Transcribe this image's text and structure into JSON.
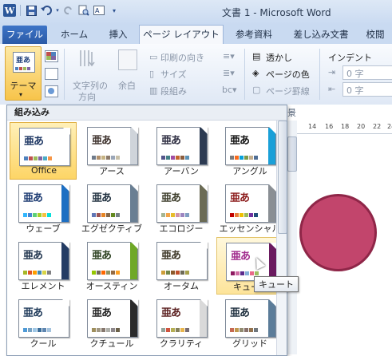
{
  "window": {
    "title": "文書 1 - Microsoft Word"
  },
  "qat": {
    "icons": [
      "word-logo-icon",
      "save-icon",
      "undo-icon",
      "redo-icon",
      "print-preview-icon",
      "customize-icon"
    ],
    "word_glyph": "W"
  },
  "tabs": [
    {
      "label": "ファイル"
    },
    {
      "label": "ホーム"
    },
    {
      "label": "挿入"
    },
    {
      "label": "ページ レイアウト"
    },
    {
      "label": "参考資料"
    },
    {
      "label": "差し込み文書"
    },
    {
      "label": "校閲"
    }
  ],
  "ribbon": {
    "theme_label": "テーマ",
    "orientation": "印刷の向き",
    "size": "サイズ",
    "columns": "段組み",
    "text_direction_1": "文字列の",
    "text_direction_2": "方向",
    "margins": "余白",
    "watermark": "透かし",
    "page_color": "ページの色",
    "page_borders": "ページ罫線",
    "indent": "インデント",
    "indent_left": "0 字",
    "indent_right": "0 字",
    "background_group": "景"
  },
  "ruler": {
    "ticks": [
      "14",
      "16",
      "18",
      "20",
      "22",
      "24"
    ]
  },
  "gallery": {
    "header": "組み込み",
    "items": [
      {
        "label": "Office",
        "jp": "亜あ",
        "text_color": "#1f3864",
        "stripe": "",
        "swatches": [
          "#4f81bd",
          "#c0504d",
          "#9bbb59",
          "#8064a2",
          "#4bacc6",
          "#f79646"
        ]
      },
      {
        "label": "アース",
        "jp": "亜あ",
        "text_color": "#3b2f2a",
        "stripe": "#cfd4da",
        "swatches": [
          "#6f7b8b",
          "#b1906b",
          "#c6b383",
          "#8d7b6b",
          "#9aa6b8",
          "#c7bfa8"
        ]
      },
      {
        "label": "アーバン",
        "jp": "亜あ",
        "text_color": "#2b2b3f",
        "stripe": "#2d3b52",
        "swatches": [
          "#53548a",
          "#438086",
          "#a04da3",
          "#c4652d",
          "#8b5d3d",
          "#5c92b5"
        ]
      },
      {
        "label": "アングル",
        "jp": "亜あ",
        "text_color": "#111111",
        "stripe": "#1aa0d8",
        "swatches": [
          "#797b7e",
          "#f96a1b",
          "#08a1d9",
          "#7c984a",
          "#c2ad8d",
          "#506e94"
        ]
      },
      {
        "label": "ウェーブ",
        "jp": "亜あ",
        "text_color": "#1d3b72",
        "stripe": "#1e6fc2",
        "swatches": [
          "#31b6fd",
          "#4584d3",
          "#5bd078",
          "#a5d028",
          "#f5c040",
          "#05e0db"
        ]
      },
      {
        "label": "エグゼクティブ",
        "jp": "亜あ",
        "text_color": "#20303f",
        "stripe": "#6a7f93",
        "swatches": [
          "#6076b4",
          "#9c5252",
          "#e68422",
          "#846648",
          "#63891f",
          "#758085"
        ]
      },
      {
        "label": "エコロジー",
        "jp": "亜あ",
        "text_color": "#3c3c2a",
        "stripe": "#6b6b55",
        "swatches": [
          "#a5b592",
          "#f3a447",
          "#e7bc29",
          "#d092a7",
          "#9c85c0",
          "#809ec2"
        ]
      },
      {
        "label": "エッセンシャル",
        "jp": "亜あ",
        "text_color": "#8b1a1a",
        "stripe": "#8a8f94",
        "swatches": [
          "#c00000",
          "#e87d37",
          "#eec000",
          "#9bbb59",
          "#7030a0",
          "#1f4e79"
        ]
      },
      {
        "label": "エレメント",
        "jp": "亜あ",
        "text_color": "#22364f",
        "stripe": "#243c64",
        "swatches": [
          "#a6b727",
          "#df5327",
          "#fe9e00",
          "#418ab3",
          "#d7d447",
          "#818183"
        ]
      },
      {
        "label": "オースティン",
        "jp": "亜あ",
        "text_color": "#2a3f1e",
        "stripe": "#6fa827",
        "swatches": [
          "#94c600",
          "#71685a",
          "#ff6700",
          "#909465",
          "#956b43",
          "#fea022"
        ]
      },
      {
        "label": "オータム",
        "jp": "亜あ",
        "text_color": "#3b3525",
        "stripe": "",
        "swatches": [
          "#ce9e3a",
          "#72874a",
          "#8c5a2b",
          "#c04f2a",
          "#6e6a57",
          "#a7a14b"
        ]
      },
      {
        "label": "キュート",
        "jp": "亜あ",
        "text_color": "#a02a8c",
        "stripe": "#6a1a5f",
        "swatches": [
          "#8e1a60",
          "#ce6ba3",
          "#5c2a8b",
          "#84b0d8",
          "#e86a8a",
          "#9cbf5f"
        ]
      },
      {
        "label": "クール",
        "jp": "亜あ",
        "text_color": "#1f3a5a",
        "stripe": "",
        "swatches": [
          "#4e9ad6",
          "#76a2c4",
          "#9ec7e6",
          "#3b6e9b",
          "#5e86b0",
          "#a4c3de"
        ]
      },
      {
        "label": "クチュール",
        "jp": "亜あ",
        "text_color": "#222222",
        "stripe": "#2b2b2b",
        "swatches": [
          "#9e8e5c",
          "#a09781",
          "#85776d",
          "#aeafa9",
          "#8d878b",
          "#6b6149"
        ]
      },
      {
        "label": "クラリティ",
        "jp": "亜あ",
        "text_color": "#5a1f1f",
        "stripe": "#d9d9d9",
        "swatches": [
          "#93a299",
          "#cf543f",
          "#b5ae53",
          "#848058",
          "#e8b54d",
          "#786c71"
        ]
      },
      {
        "label": "グリッド",
        "jp": "亜あ",
        "text_color": "#1e2f3e",
        "stripe": "#5b7c99",
        "swatches": [
          "#c66951",
          "#bf974d",
          "#928b70",
          "#87706b",
          "#94734e",
          "#6f777d"
        ]
      }
    ],
    "tooltip": "キュート"
  },
  "colors": {
    "accent_blue": "#2b579a",
    "selected_tile": "#fdd566",
    "shape_fill": "#c2456c",
    "shape_border": "#8f2648"
  }
}
